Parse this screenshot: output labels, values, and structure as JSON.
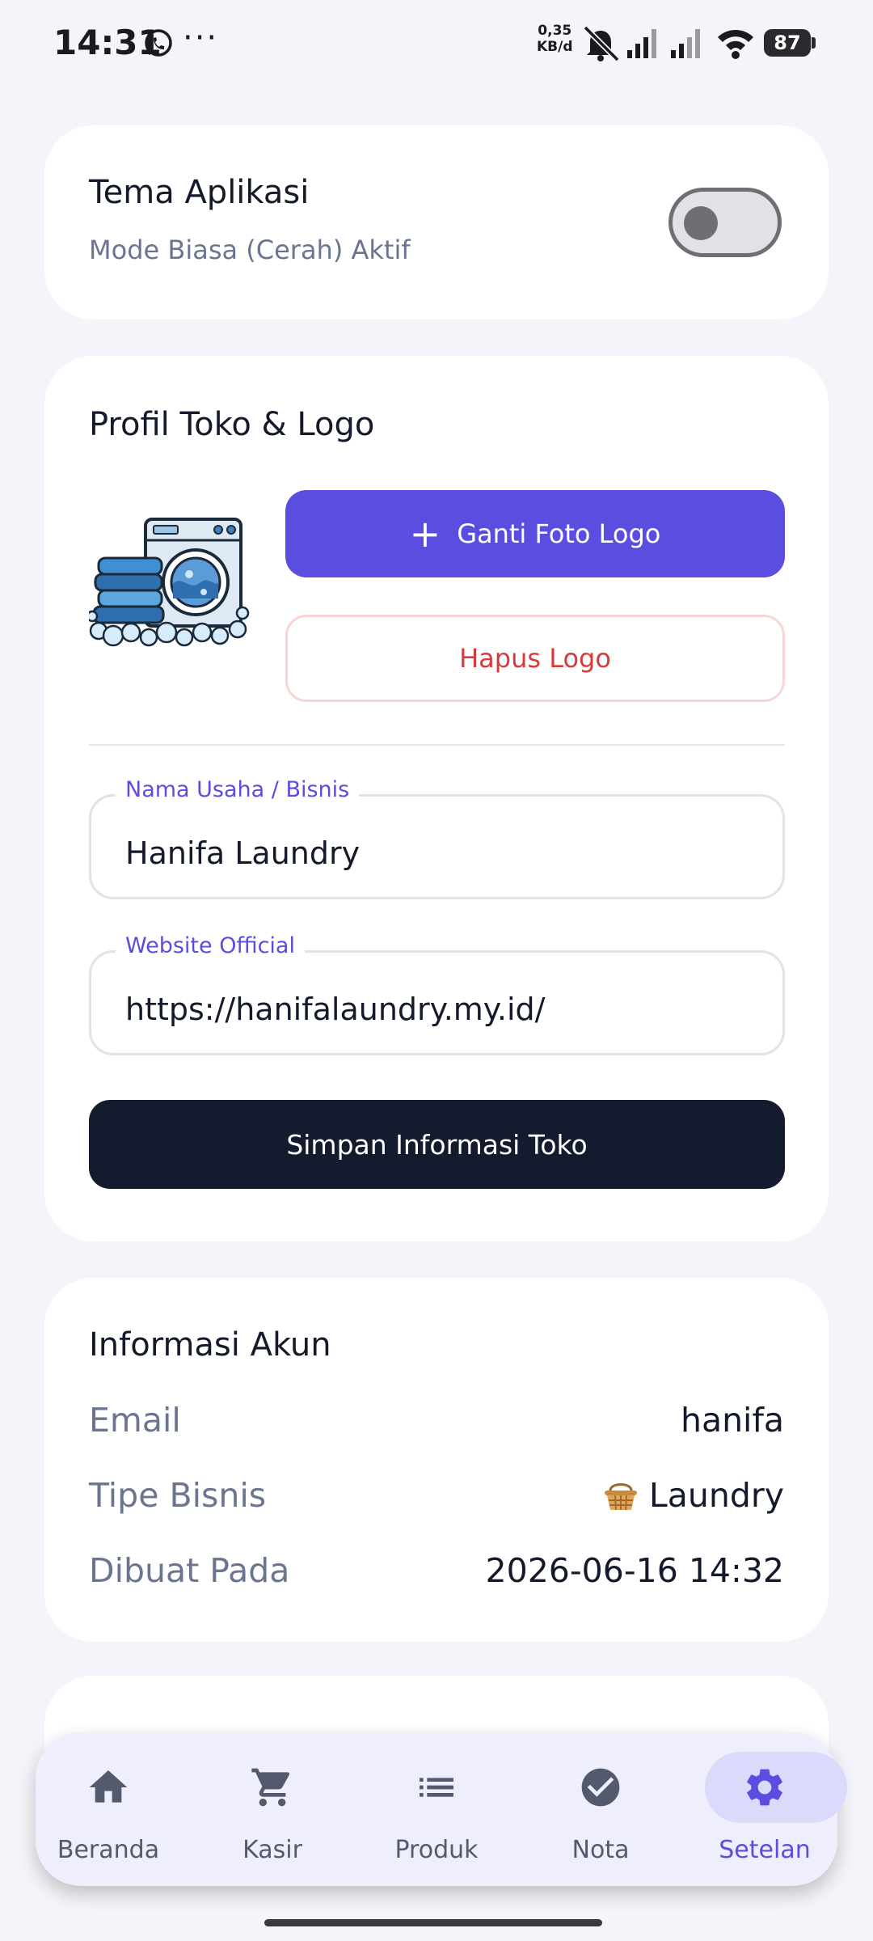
{
  "status_bar": {
    "time": "14:31",
    "net_speed_value": "0,35",
    "net_speed_unit": "KB/d",
    "battery": "87",
    "icons": [
      "whatsapp-icon",
      "more-dots-icon",
      "mute-icon",
      "signal-icon",
      "signal-icon",
      "wifi-icon",
      "battery-icon"
    ]
  },
  "theme": {
    "title": "Tema Aplikasi",
    "subtitle": "Mode Biasa (Cerah) Aktif",
    "toggle_on": false
  },
  "profile": {
    "title": "Profil Toko & Logo",
    "change_logo_label": "Ganti Foto Logo",
    "remove_logo_label": "Hapus Logo",
    "business_name_label": "Nama Usaha / Bisnis",
    "business_name_value": "Hanifa Laundry",
    "website_label": "Website Official",
    "website_value": "https://hanifalaundry.my.id/",
    "save_label": "Simpan Informasi Toko"
  },
  "account": {
    "title": "Informasi Akun",
    "rows": [
      {
        "label": "Email",
        "value": "hanifa"
      },
      {
        "label": "Tipe Bisnis",
        "value": "Laundry"
      },
      {
        "label": "Dibuat Pada",
        "value": "2026-06-16 14:32"
      }
    ]
  },
  "nav": {
    "items": [
      {
        "label": "Beranda",
        "icon": "home-icon"
      },
      {
        "label": "Kasir",
        "icon": "cart-icon"
      },
      {
        "label": "Produk",
        "icon": "list-icon"
      },
      {
        "label": "Nota",
        "icon": "check-circle-icon"
      },
      {
        "label": "Setelan",
        "icon": "gear-icon"
      }
    ],
    "active": "Setelan"
  },
  "colors": {
    "accent": "#5b4ddf",
    "danger": "#d83a3a",
    "dark_button": "#141b2e",
    "background": "#f4f5fa"
  }
}
